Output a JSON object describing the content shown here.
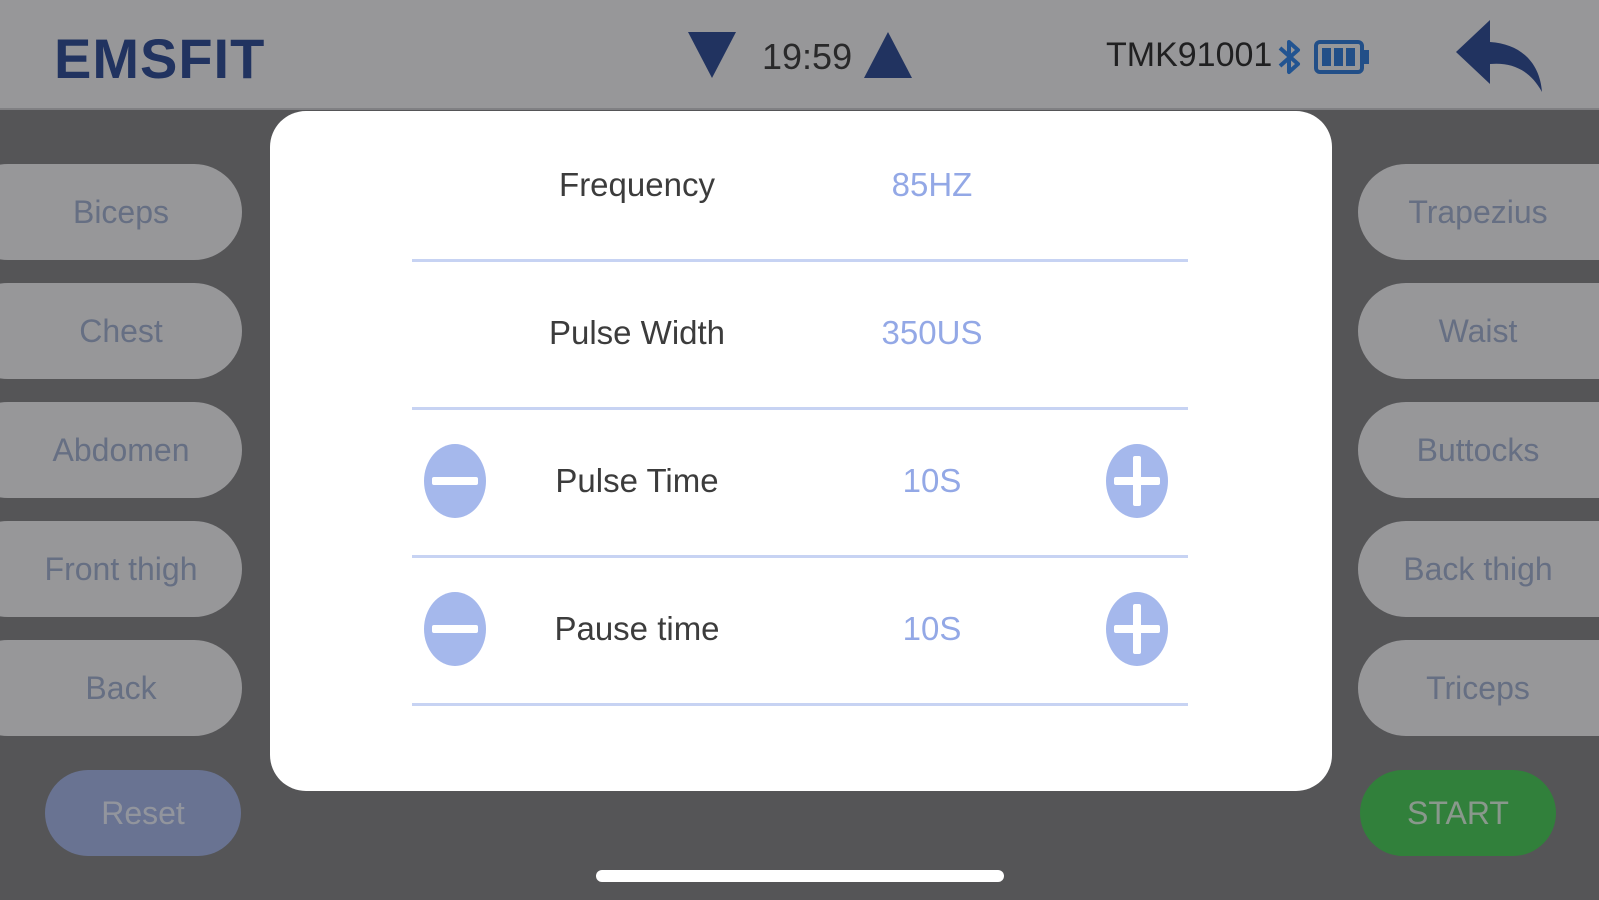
{
  "header": {
    "brand": "EMSFIT",
    "time": "19:59",
    "device_id": "TMK91001"
  },
  "muscles": {
    "left": [
      "Biceps",
      "Chest",
      "Abdomen",
      "Front thigh",
      "Back"
    ],
    "right": [
      "Trapezius",
      "Waist",
      "Buttocks",
      "Back thigh",
      "Triceps"
    ]
  },
  "actions": {
    "reset_label": "Reset",
    "start_label": "START"
  },
  "settings": {
    "frequency": {
      "label": "Frequency",
      "value": "85HZ"
    },
    "pulse_width": {
      "label": "Pulse Width",
      "value": "350US"
    },
    "pulse_time": {
      "label": "Pulse Time",
      "value": "10S"
    },
    "pause_time": {
      "label": "Pause time",
      "value": "10S"
    }
  },
  "colors": {
    "accent": "#93a8e6",
    "brand": "#1d3c8c",
    "start": "#39c84a"
  },
  "icons": {
    "decrease": "minus-circle-icon",
    "increase": "plus-circle-icon",
    "back": "back-arrow-icon",
    "bluetooth": "bluetooth-icon",
    "battery": "battery-icon"
  }
}
